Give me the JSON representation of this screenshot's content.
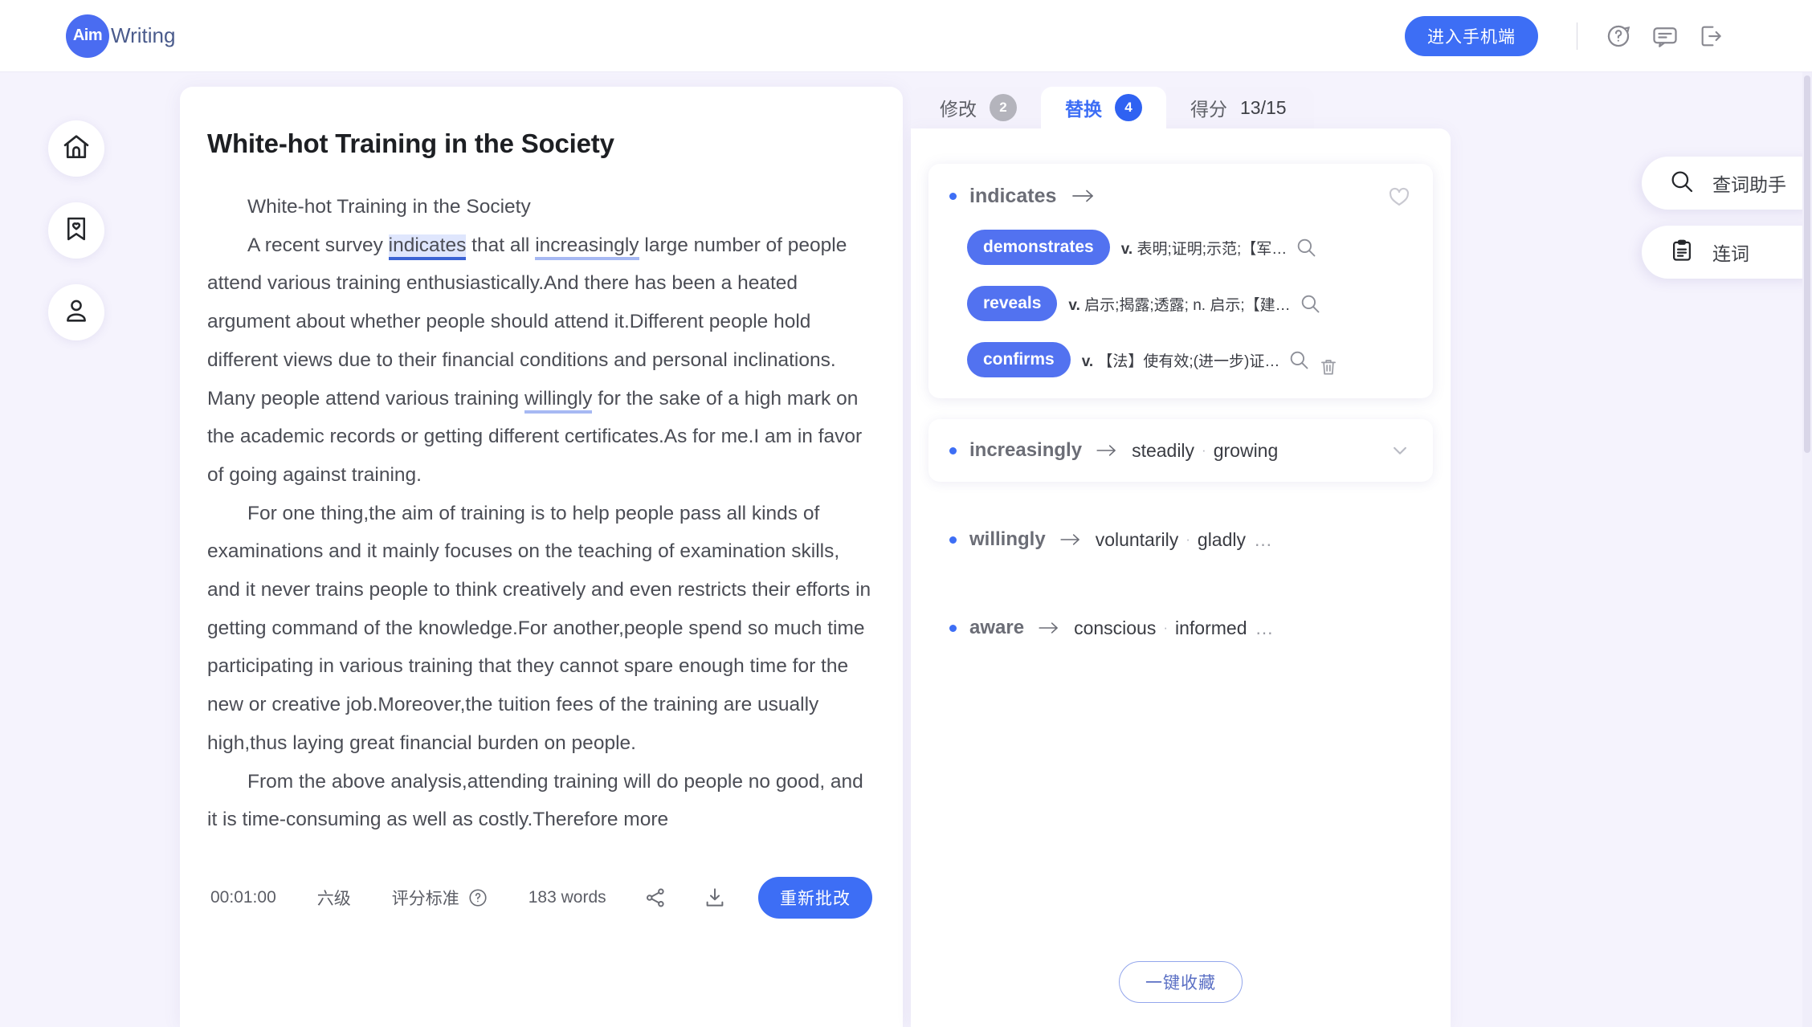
{
  "header": {
    "logo_badge": "Aim",
    "logo_text": "Writing",
    "mobile_button": "进入手机端",
    "icons": [
      "help-circle-icon",
      "message-icon",
      "logout-icon"
    ]
  },
  "left_rail": {
    "items": [
      {
        "name": "home-icon"
      },
      {
        "name": "bookmark-heart-icon"
      },
      {
        "name": "user-icon"
      }
    ]
  },
  "document": {
    "title": "White-hot Training in the Society",
    "paragraphs": [
      {
        "plain": "White-hot Training in the Society"
      }
    ],
    "p2_pre": "A recent survey ",
    "p2_hl1": "indicates",
    "p2_mid1": " that all ",
    "p2_hl2": "increasingly",
    "p2_mid2": " large number of people attend various training enthusiastically.And there has been a heated argument about whether people should attend it.Different people hold different views due to their financial conditions and personal inclinations. Many people attend various training ",
    "p2_hl3": "willingly",
    "p2_post": " for the sake of a high mark on the academic records or getting different certificates.As for me.I am in favor of going against training.",
    "p3": "For one thing,the aim of training is to help people pass all kinds of examinations and it mainly focuses on the teaching of examination skills, and it never trains people to think creatively and even restricts their efforts in getting command of the knowledge.For another,people spend so much time participating in various training that they cannot spare enough time for the new or creative job.Moreover,the tuition fees of the training are usually high,thus laying great financial burden on people.",
    "p4": "From the above analysis,attending training will do people no good, and it is time-consuming as well as costly.Therefore more",
    "toolbar": {
      "timer": "00:01:00",
      "level": "六级",
      "criteria": "评分标准",
      "criteria_icon": "help-circle-icon",
      "word_count": "183 words",
      "share_icon": "share-icon",
      "download_icon": "download-icon",
      "redo_button": "重新批改"
    }
  },
  "right_panel": {
    "tabs": [
      {
        "label": "修改",
        "badge": "2",
        "active": false
      },
      {
        "label": "替换",
        "badge": "4",
        "active": true
      },
      {
        "label": "得分",
        "score": "13/15",
        "active": false
      }
    ],
    "expanded": {
      "word": "indicates",
      "arrow": "→",
      "favorite_icon": "heart-outline-icon",
      "synonyms": [
        {
          "word": "demonstrates",
          "pos": "v.",
          "definition": "表明;证明;示范;【军…"
        },
        {
          "word": "reveals",
          "pos": "v.",
          "definition": "启示;揭露;透露; n. 启示;【建…"
        },
        {
          "word": "confirms",
          "pos": "v.",
          "definition": "【法】使有效;(进一步)证…"
        }
      ],
      "delete_icon": "trash-icon",
      "search_icon": "search-icon"
    },
    "collapsed": [
      {
        "word": "increasingly",
        "arrow": "→",
        "synonyms": [
          "steadily",
          "growing"
        ],
        "separator": "·",
        "ellipsis": "",
        "chevron": "chevron-down-icon",
        "boxed": true
      },
      {
        "word": "willingly",
        "arrow": "→",
        "synonyms": [
          "voluntarily",
          "gladly"
        ],
        "separator": "·",
        "ellipsis": "…",
        "boxed": false
      },
      {
        "word": "aware",
        "arrow": "→",
        "synonyms": [
          "conscious",
          "informed"
        ],
        "separator": "·",
        "ellipsis": "…",
        "boxed": false
      }
    ],
    "favorite_all_button": "一键收藏"
  },
  "float_tools": [
    {
      "label": "查词助手",
      "icon": "search-icon"
    },
    {
      "label": "连词",
      "icon": "clipboard-icon"
    }
  ]
}
